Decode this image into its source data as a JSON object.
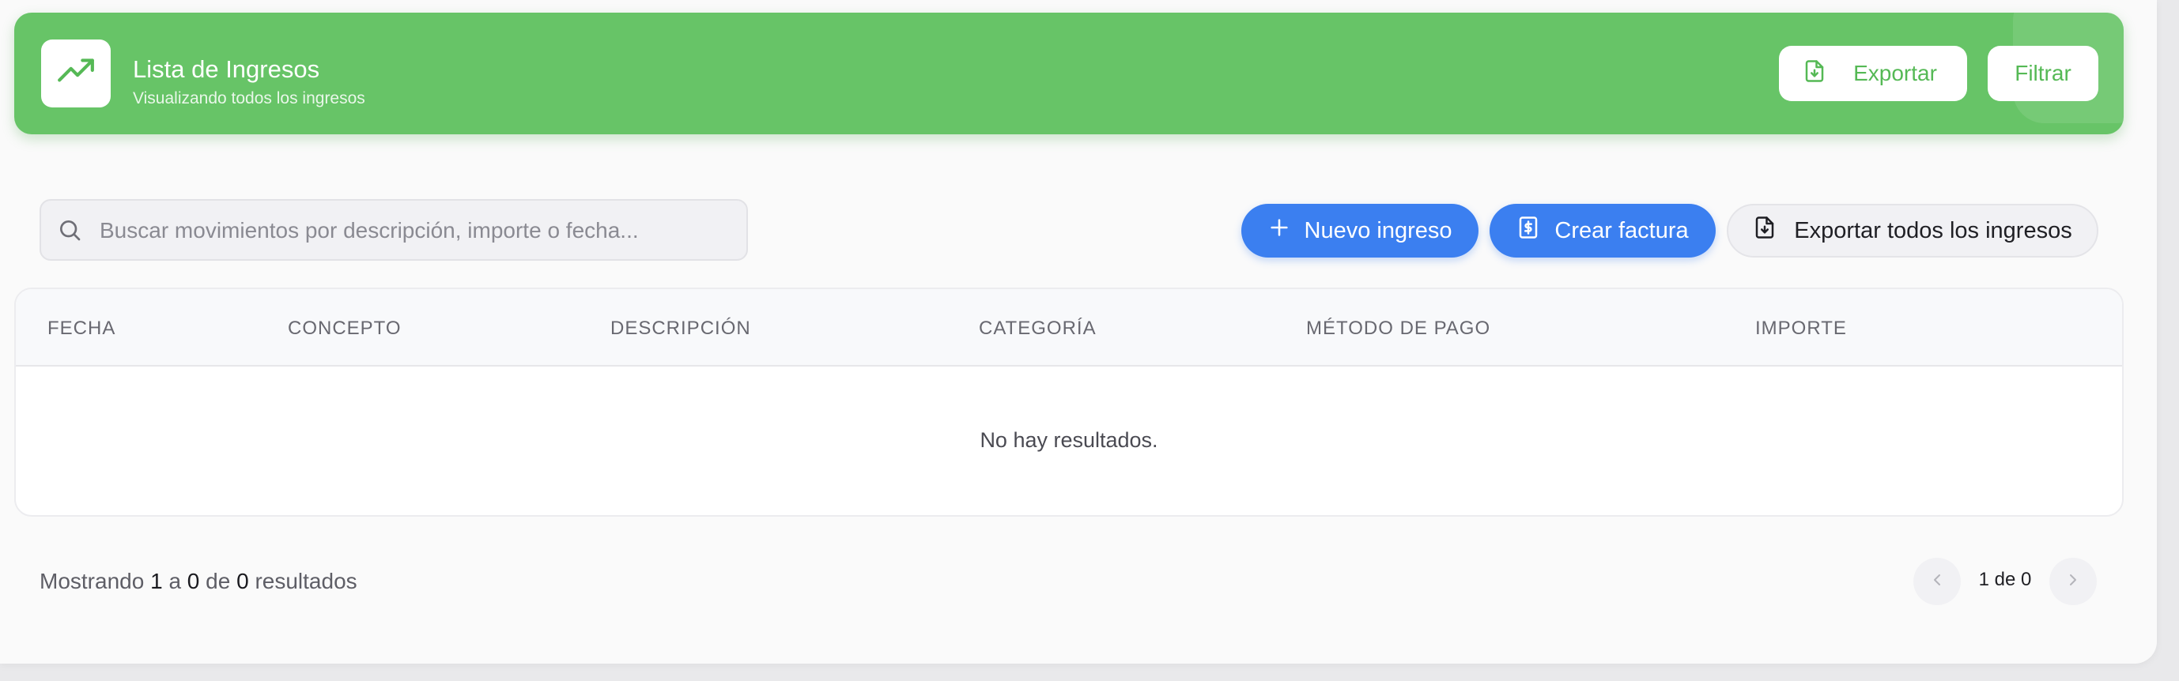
{
  "header": {
    "title": "Lista de Ingresos",
    "subtitle": "Visualizando todos los ingresos",
    "logo_icon": "trending-up-icon",
    "export_label": "Exportar",
    "filter_label": "Filtrar",
    "accent_color": "#67c467"
  },
  "toolbar": {
    "search_placeholder": "Buscar movimientos por descripción, importe o fecha...",
    "search_value": "",
    "new_income_label": "Nuevo ingreso",
    "create_invoice_label": "Crear factura",
    "export_all_label": "Exportar todos los ingresos",
    "primary_color": "#3b7ff0"
  },
  "table": {
    "columns": [
      "FECHA",
      "CONCEPTO",
      "DESCRIPCIÓN",
      "CATEGORÍA",
      "MÉTODO DE PAGO",
      "IMPORTE"
    ],
    "rows": [],
    "empty_message": "No hay resultados."
  },
  "footer": {
    "showing_prefix": "Mostrando",
    "from": "1",
    "to_word": "a",
    "to": "0",
    "of_word": "de",
    "total": "0",
    "results_word": "resultados",
    "page_label": "1 de 0"
  }
}
